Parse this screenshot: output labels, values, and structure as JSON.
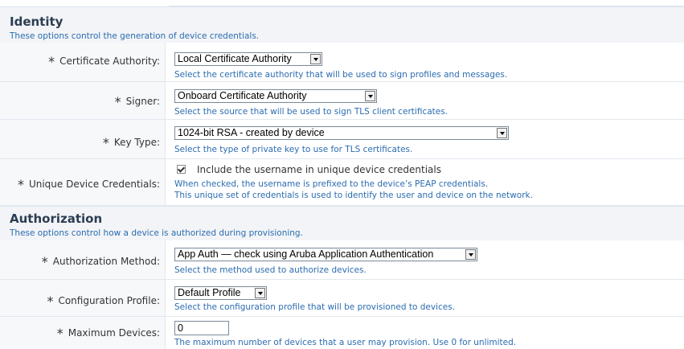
{
  "identity": {
    "title": "Identity",
    "description": "These options control the generation of device credentials.",
    "fields": {
      "ca": {
        "label": "Certificate Authority:",
        "value": "Local Certificate Authority",
        "hint": "Select the certificate authority that will be used to sign profiles and messages."
      },
      "signer": {
        "label": "Signer:",
        "value": "Onboard Certificate Authority",
        "hint": "Select the source that will be used to sign TLS client certificates."
      },
      "key_type": {
        "label": "Key Type:",
        "value": "1024-bit RSA - created by device",
        "hint": "Select the type of private key to use for TLS certificates."
      },
      "unique": {
        "label": "Unique Device Credentials:",
        "checkbox_label": "Include the username in unique device credentials",
        "checked": true,
        "hint1": "When checked, the username is prefixed to the device’s PEAP credentials.",
        "hint2": "This unique set of credentials is used to identify the user and device on the network."
      }
    }
  },
  "authorization": {
    "title": "Authorization",
    "description": "These options control how a device is authorized during provisioning.",
    "fields": {
      "method": {
        "label": "Authorization Method:",
        "value": "App Auth — check using Aruba Application Authentication",
        "hint": "Select the method used to authorize devices."
      },
      "profile": {
        "label": "Configuration Profile:",
        "value": "Default Profile",
        "hint": "Select the configuration profile that will be provisioned to devices."
      },
      "max_devices": {
        "label": "Maximum Devices:",
        "value": "0",
        "hint": "The maximum number of devices that a user may provision. Use 0 for unlimited."
      }
    }
  },
  "required_marker": "*",
  "colors": {
    "hint": "#2b6cb0",
    "section_bg": "#f2f4f7",
    "label_bg": "#f7f8fa"
  }
}
